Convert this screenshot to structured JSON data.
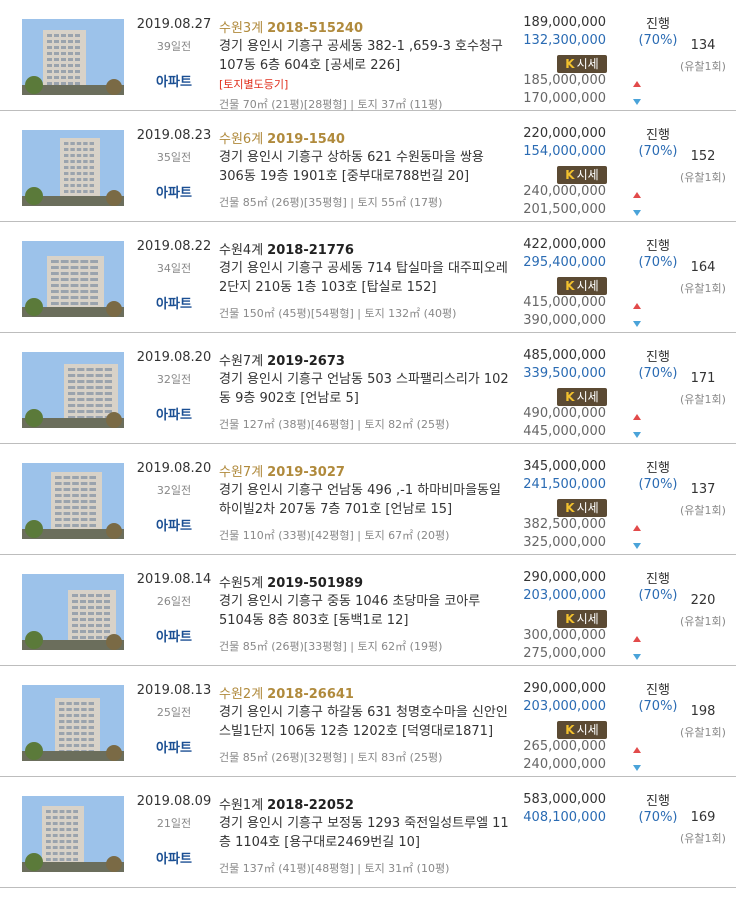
{
  "colors": {
    "accent_blue": "#2a6bb3",
    "gold": "#b08a3c",
    "red": "#e0301e",
    "link_blue": "#1b4f93"
  },
  "items": [
    {
      "date": "2019.08.27",
      "ago": "39일전",
      "type": "아파트",
      "court": "수원3계",
      "case_no": "2018-515240",
      "gold": true,
      "address": "경기 용인시 기흥구 공세동 382-1 ,659-3 호수청구 107동 6층 604호 [공세로 226]",
      "note": "[토지별도등기]",
      "area": "건물 70㎡ (21평)[28평형] | 토지 37㎡ (11평)",
      "appraisal": "189,000,000",
      "min_price": "132,300,000",
      "sise": "시세",
      "price_high": "185,000,000",
      "price_low": "170,000,000",
      "status": "진행",
      "ratio": "(70%)",
      "views": "134",
      "fail": "(유찰1회)",
      "photo_icon": "apartment-photo-icon"
    },
    {
      "date": "2019.08.23",
      "ago": "35일전",
      "type": "아파트",
      "court": "수원6계",
      "case_no": "2019-1540",
      "gold": true,
      "address": "경기 용인시 기흥구 상하동 621 수원동마을 쌍용 306동 19층 1901호 [중부대로788번길 20]",
      "note": "",
      "area": "건물 85㎡ (26평)[35평형] | 토지 55㎡ (17평)",
      "appraisal": "220,000,000",
      "min_price": "154,000,000",
      "sise": "시세",
      "price_high": "240,000,000",
      "price_low": "201,500,000",
      "status": "진행",
      "ratio": "(70%)",
      "views": "152",
      "fail": "(유찰1회)",
      "photo_icon": "apartment-photo-icon"
    },
    {
      "date": "2019.08.22",
      "ago": "34일전",
      "type": "아파트",
      "court": "수원4계",
      "case_no": "2018-21776",
      "gold": false,
      "address": "경기 용인시 기흥구 공세동 714 탑실마을 대주피오레2단지 210동 1층 103호 [탑실로 152]",
      "note": "",
      "area": "건물 150㎡ (45평)[54평형] | 토지 132㎡ (40평)",
      "appraisal": "422,000,000",
      "min_price": "295,400,000",
      "sise": "시세",
      "price_high": "415,000,000",
      "price_low": "390,000,000",
      "status": "진행",
      "ratio": "(70%)",
      "views": "164",
      "fail": "(유찰1회)",
      "photo_icon": "apartment-photo-icon"
    },
    {
      "date": "2019.08.20",
      "ago": "32일전",
      "type": "아파트",
      "court": "수원7계",
      "case_no": "2019-2673",
      "gold": false,
      "address": "경기 용인시 기흥구 언남동 503 스파팰리스리가 102동 9층 902호 [언남로 5]",
      "note": "",
      "area": "건물 127㎡ (38평)[46평형] | 토지 82㎡ (25평)",
      "appraisal": "485,000,000",
      "min_price": "339,500,000",
      "sise": "시세",
      "price_high": "490,000,000",
      "price_low": "445,000,000",
      "status": "진행",
      "ratio": "(70%)",
      "views": "171",
      "fail": "(유찰1회)",
      "photo_icon": "apartment-photo-icon"
    },
    {
      "date": "2019.08.20",
      "ago": "32일전",
      "type": "아파트",
      "court": "수원7계",
      "case_no": "2019-3027",
      "gold": true,
      "address": "경기 용인시 기흥구 언남동 496 ,-1 하마비마을동일하이빌2차 207동 7층 701호 [언남로 15]",
      "note": "",
      "area": "건물 110㎡ (33평)[42평형] | 토지 67㎡ (20평)",
      "appraisal": "345,000,000",
      "min_price": "241,500,000",
      "sise": "시세",
      "price_high": "382,500,000",
      "price_low": "325,000,000",
      "status": "진행",
      "ratio": "(70%)",
      "views": "137",
      "fail": "(유찰1회)",
      "photo_icon": "apartment-photo-icon"
    },
    {
      "date": "2019.08.14",
      "ago": "26일전",
      "type": "아파트",
      "court": "수원5계",
      "case_no": "2019-501989",
      "gold": false,
      "address": "경기 용인시 기흥구 중동 1046 초당마을 코아루 5104동 8층 803호 [동백1로 12]",
      "note": "",
      "area": "건물 85㎡ (26평)[33평형] | 토지 62㎡ (19평)",
      "appraisal": "290,000,000",
      "min_price": "203,000,000",
      "sise": "시세",
      "price_high": "300,000,000",
      "price_low": "275,000,000",
      "status": "진행",
      "ratio": "(70%)",
      "views": "220",
      "fail": "(유찰1회)",
      "photo_icon": "apartment-photo-icon"
    },
    {
      "date": "2019.08.13",
      "ago": "25일전",
      "type": "아파트",
      "court": "수원2계",
      "case_no": "2018-26641",
      "gold": true,
      "address": "경기 용인시 기흥구 하갈동 631 청명호수마을 신안인스빌1단지 106동 12층 1202호 [덕영대로1871]",
      "note": "",
      "area": "건물 85㎡ (26평)[32평형] | 토지 83㎡ (25평)",
      "appraisal": "290,000,000",
      "min_price": "203,000,000",
      "sise": "시세",
      "price_high": "265,000,000",
      "price_low": "240,000,000",
      "status": "진행",
      "ratio": "(70%)",
      "views": "198",
      "fail": "(유찰1회)",
      "photo_icon": "apartment-photo-icon"
    },
    {
      "date": "2019.08.09",
      "ago": "21일전",
      "type": "아파트",
      "court": "수원1계",
      "case_no": "2018-22052",
      "gold": false,
      "address": "경기 용인시 기흥구 보정동 1293 죽전일성트루엘 11층 1104호 [용구대로2469번길 10]",
      "note": "",
      "area": "건물 137㎡ (41평)[48평형] | 토지 31㎡ (10평)",
      "appraisal": "583,000,000",
      "min_price": "408,100,000",
      "sise": "",
      "price_high": "",
      "price_low": "",
      "status": "진행",
      "ratio": "(70%)",
      "views": "169",
      "fail": "(유찰1회)",
      "photo_icon": "apartment-photo-icon"
    }
  ]
}
